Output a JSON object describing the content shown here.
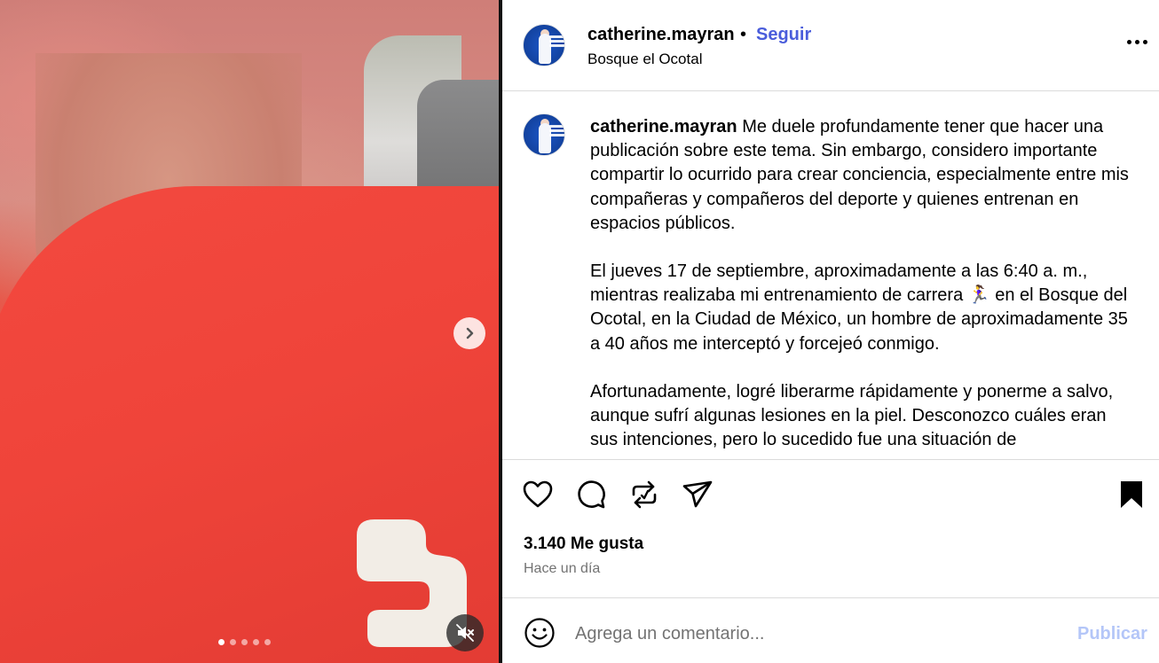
{
  "post": {
    "username": "catherine.mayran",
    "separator": "•",
    "follow_label": "Seguir",
    "location": "Bosque el Ocotal",
    "more_icon": "more-horizontal-icon"
  },
  "caption": {
    "username": "catherine.mayran",
    "paragraphs": [
      "Me duele profundamente tener que hacer una publicación sobre este tema. Sin embargo, considero importante compartir lo ocurrido para crear conciencia, especialmente entre mis compañeras y compañeros del deporte y quienes entrenan en espacios públicos.",
      "El jueves 17 de septiembre, aproximadamente a las 6:40 a. m., mientras realizaba mi entrenamiento de carrera 🏃‍♀️ en el Bosque del Ocotal, en la Ciudad de México, un hombre de aproximadamente 35 a 40 años me interceptó y forcejeó conmigo.",
      "Afortunadamente, logré liberarme rápidamente y ponerme a salvo, aunque sufrí algunas lesiones en la piel. Desconozco cuáles eran sus intenciones, pero lo sucedido fue una situación de"
    ]
  },
  "stats": {
    "likes": "3.140 Me gusta",
    "time": "Hace un día"
  },
  "comment": {
    "placeholder": "Agrega un comentario...",
    "publish_label": "Publicar"
  },
  "media": {
    "carousel_count": 5,
    "active_index": 0
  },
  "colors": {
    "follow": "#4a5ddb",
    "publish_disabled": "#b4c6f8",
    "secondary_text": "#737373"
  }
}
